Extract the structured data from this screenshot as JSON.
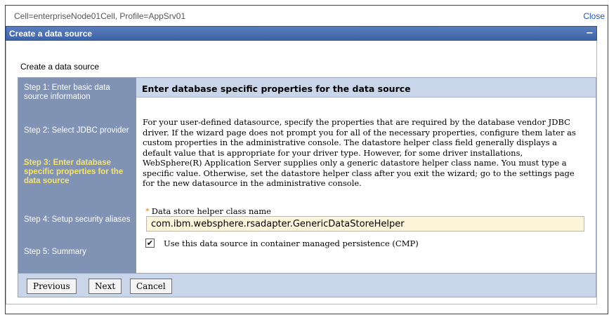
{
  "header": {
    "cell_profile": "Cell=enterpriseNode01Cell, Profile=AppSrv01",
    "close_label": "Close"
  },
  "panel": {
    "title": "Create a data source",
    "collapse_symbol": "−"
  },
  "wizard": {
    "label": "Create a data source",
    "steps": [
      {
        "label": "Step 1: Enter basic data source information",
        "current": false
      },
      {
        "label": "Step 2: Select JDBC provider",
        "current": false
      },
      {
        "label": "Step 3: Enter database specific properties for the data source",
        "current": true
      },
      {
        "label": "Step 4: Setup security aliases",
        "current": false
      },
      {
        "label": "Step 5: Summary",
        "current": false
      }
    ],
    "current_marker": "→",
    "content_title": "Enter database specific properties for the data source",
    "description": "For your user-defined datasource, specify the properties that are required by the database vendor JDBC driver. If the wizard page does not prompt you for all of the necessary properties, configure them later as custom properties in the administrative console. The datastore helper class field generally displays a default value that is appropriate for your driver type. However, for some driver installations, WebSphere(R) Application Server supplies only a generic datastore helper class name. You must type a specific value. Otherwise, set the datastore helper class after you exit the wizard; go to the settings page for the new datasource in the administrative console.",
    "helper_field": {
      "required_marker": "*",
      "label": "Data store helper class name",
      "value": "com.ibm.websphere.rsadapter.GenericDataStoreHelper"
    },
    "cmp": {
      "checked": true,
      "check_glyph": "✔",
      "label": "Use this data source in container managed persistence (CMP)"
    }
  },
  "buttons": {
    "previous": "Previous",
    "next": "Next",
    "cancel": "Cancel"
  },
  "colors": {
    "header_blue": "#3e64a8",
    "steps_bg": "#8093b4",
    "current_step": "#f7e36a",
    "content_head_bg": "#c9d6ea",
    "input_bg": "#fdf5d9",
    "link": "#1a52c2"
  }
}
